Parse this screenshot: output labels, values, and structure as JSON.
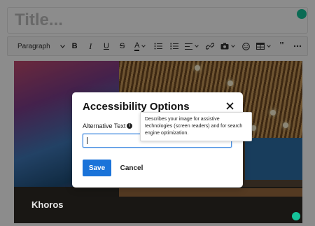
{
  "editor": {
    "title_placeholder": "Title..."
  },
  "toolbar": {
    "block_format": "Paragraph",
    "icons": [
      "bold-icon",
      "italic-icon",
      "underline-icon",
      "strikethrough-icon",
      "text-color-icon",
      "bullet-list-icon",
      "numbered-list-icon",
      "align-icon",
      "link-icon",
      "camera-icon",
      "emoji-icon",
      "table-icon",
      "quote-icon",
      "more-icon"
    ]
  },
  "image": {
    "brand_text": "Khoros"
  },
  "modal": {
    "title": "Accessibility Options",
    "alt_label": "Alternative Text",
    "alt_value": "",
    "save_label": "Save",
    "cancel_label": "Cancel"
  },
  "tooltip": {
    "text": "Describes your image for assistive technologies (screen readers) and for search engine optimization."
  },
  "colors": {
    "primary_button": "#1a73d9",
    "input_focus": "#4a90e2",
    "grammarly": "#15c39a"
  }
}
